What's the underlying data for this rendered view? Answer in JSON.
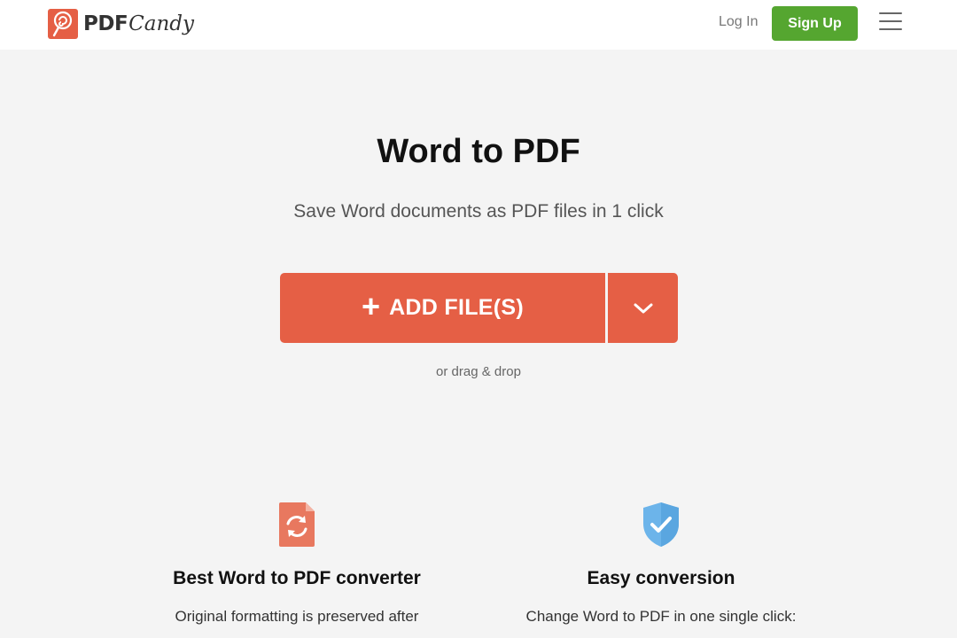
{
  "header": {
    "logo_pdf": "PDF",
    "logo_candy": "Candy",
    "login_label": "Log In",
    "signup_label": "Sign Up",
    "menu_icon": "hamburger-menu-icon"
  },
  "main": {
    "title": "Word to PDF",
    "subtitle": "Save Word documents as PDF files in 1 click",
    "add_files_label": "ADD FILE(S)",
    "plus_symbol": "+",
    "drag_drop_text": "or drag & drop"
  },
  "features": [
    {
      "icon": "file-convert-icon",
      "title": "Best Word to PDF converter",
      "text": "Original formatting is preserved after"
    },
    {
      "icon": "shield-check-icon",
      "title": "Easy conversion",
      "text": "Change Word to PDF in one single click:"
    }
  ],
  "colors": {
    "brand": "#e55f45",
    "signup": "#55a630",
    "background": "#f4f4f4",
    "shield": "#6cb4ea"
  }
}
